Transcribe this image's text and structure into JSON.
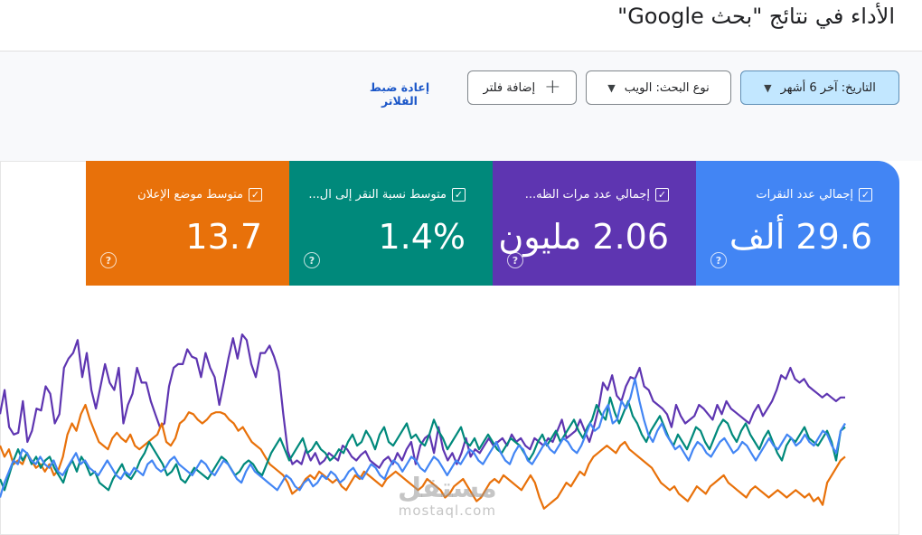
{
  "header": {
    "title": "الأداء في نتائج \"بحث Google\""
  },
  "filters": {
    "date_label": "التاريخ: آخر 6 أشهر",
    "search_type_label": "نوع البحث: الويب",
    "add_filter_label": "إضافة فلتر",
    "reset_label": "إعادة ضبط الفلاتر"
  },
  "metrics": [
    {
      "label": "إجمالي عدد النقرات",
      "value": "29.6 ألف",
      "color": "#4285f4",
      "checked": true
    },
    {
      "label": "إجمالي عدد مرات الظه...",
      "value": "2.06 مليون",
      "color": "#5e35b1",
      "checked": true
    },
    {
      "label": "متوسط نسبة النقر إلى ال...",
      "value": "1.4%",
      "color": "#00897b",
      "checked": true
    },
    {
      "label": "متوسط موضع الإعلان",
      "value": "13.7",
      "color": "#e8710a",
      "checked": true
    }
  ],
  "watermark": {
    "arabic": "مستقل",
    "latin": "mostaql.com"
  },
  "chart_data": {
    "type": "line",
    "series": [
      {
        "color": "#5e35b1",
        "values": [
          0.55,
          0.68,
          0.48,
          0.44,
          0.45,
          0.62,
          0.4,
          0.46,
          0.58,
          0.57,
          0.7,
          0.66,
          0.5,
          0.55,
          0.8,
          0.85,
          0.88,
          0.95,
          0.75,
          0.88,
          0.68,
          0.58,
          0.7,
          0.82,
          0.72,
          0.68,
          0.8,
          0.5,
          0.6,
          0.66,
          0.8,
          0.72,
          0.72,
          0.62,
          0.55,
          0.48,
          0.5,
          0.7,
          0.8,
          0.82,
          0.82,
          0.9,
          0.86,
          0.85,
          0.75,
          0.88,
          0.8,
          0.75,
          0.6,
          0.72,
          0.85,
          0.96,
          0.85,
          0.98,
          0.95,
          0.82,
          0.75,
          0.88,
          0.88,
          0.92,
          0.86,
          0.78,
          0.55,
          0.35,
          0.28,
          0.3,
          0.28,
          0.36,
          0.3,
          0.34,
          0.28,
          0.3,
          0.34,
          0.32,
          0.3,
          0.38,
          0.36,
          0.32,
          0.3,
          0.33,
          0.35,
          0.3,
          0.28,
          0.26,
          0.3,
          0.32,
          0.28,
          0.34,
          0.3,
          0.36,
          0.4,
          0.28,
          0.38,
          0.42,
          0.44,
          0.34,
          0.48,
          0.36,
          0.3,
          0.34,
          0.28,
          0.34,
          0.42,
          0.32,
          0.36,
          0.34,
          0.38,
          0.42,
          0.38,
          0.4,
          0.42,
          0.38,
          0.44,
          0.4,
          0.42,
          0.38,
          0.36,
          0.42,
          0.4,
          0.38,
          0.42,
          0.4,
          0.46,
          0.52,
          0.42,
          0.44,
          0.46,
          0.52,
          0.46,
          0.4,
          0.48,
          0.58,
          0.72,
          0.68,
          0.76,
          0.65,
          0.62,
          0.7,
          0.75,
          0.74,
          0.8,
          0.7,
          0.68,
          0.62,
          0.6,
          0.58,
          0.55,
          0.48,
          0.6,
          0.54,
          0.5,
          0.52,
          0.54,
          0.6,
          0.58,
          0.55,
          0.52,
          0.6,
          0.55,
          0.62,
          0.58,
          0.56,
          0.54,
          0.52,
          0.5,
          0.56,
          0.6,
          0.54,
          0.58,
          0.62,
          0.68,
          0.76,
          0.74,
          0.8,
          0.74,
          0.72,
          0.74,
          0.7,
          0.68,
          0.66,
          0.64,
          0.66,
          0.64,
          0.62,
          0.64,
          0.64
        ]
      },
      {
        "color": "#e8710a",
        "values": [
          0.38,
          0.32,
          0.36,
          0.28,
          0.3,
          0.28,
          0.34,
          0.3,
          0.26,
          0.28,
          0.24,
          0.28,
          0.22,
          0.25,
          0.32,
          0.44,
          0.5,
          0.46,
          0.55,
          0.6,
          0.52,
          0.46,
          0.4,
          0.38,
          0.36,
          0.42,
          0.45,
          0.42,
          0.4,
          0.44,
          0.38,
          0.36,
          0.38,
          0.4,
          0.42,
          0.44,
          0.5,
          0.4,
          0.38,
          0.42,
          0.5,
          0.52,
          0.56,
          0.55,
          0.52,
          0.5,
          0.52,
          0.55,
          0.56,
          0.56,
          0.55,
          0.52,
          0.5,
          0.46,
          0.48,
          0.44,
          0.4,
          0.38,
          0.36,
          0.32,
          0.28,
          0.26,
          0.24,
          0.22,
          0.18,
          0.12,
          0.14,
          0.16,
          0.2,
          0.22,
          0.2,
          0.24,
          0.22,
          0.2,
          0.18,
          0.2,
          0.16,
          0.14,
          0.18,
          0.22,
          0.2,
          0.24,
          0.22,
          0.2,
          0.18,
          0.16,
          0.2,
          0.22,
          0.24,
          0.22,
          0.2,
          0.18,
          0.16,
          0.14,
          0.16,
          0.2,
          0.18,
          0.16,
          0.14,
          0.1,
          0.12,
          0.16,
          0.18,
          0.2,
          0.16,
          0.12,
          0.08,
          0.1,
          0.14,
          0.18,
          0.2,
          0.18,
          0.22,
          0.2,
          0.18,
          0.16,
          0.14,
          0.18,
          0.22,
          0.18,
          0.1,
          0.04,
          0.06,
          0.08,
          0.1,
          0.14,
          0.18,
          0.16,
          0.2,
          0.24,
          0.22,
          0.28,
          0.32,
          0.34,
          0.36,
          0.38,
          0.36,
          0.34,
          0.38,
          0.4,
          0.36,
          0.34,
          0.32,
          0.3,
          0.28,
          0.26,
          0.22,
          0.18,
          0.16,
          0.14,
          0.16,
          0.12,
          0.1,
          0.08,
          0.12,
          0.16,
          0.14,
          0.12,
          0.16,
          0.18,
          0.2,
          0.22,
          0.18,
          0.16,
          0.14,
          0.12,
          0.1,
          0.14,
          0.16,
          0.14,
          0.12,
          0.1,
          0.12,
          0.14,
          0.12,
          0.1,
          0.12,
          0.14,
          0.12,
          0.1,
          0.12,
          0.08,
          0.1,
          0.06,
          0.18,
          0.22,
          0.26,
          0.3,
          0.32
        ]
      },
      {
        "color": "#00897b",
        "values": [
          0.2,
          0.14,
          0.22,
          0.3,
          0.36,
          0.3,
          0.34,
          0.28,
          0.32,
          0.26,
          0.3,
          0.32,
          0.26,
          0.22,
          0.18,
          0.26,
          0.3,
          0.24,
          0.32,
          0.28,
          0.22,
          0.24,
          0.18,
          0.16,
          0.14,
          0.2,
          0.24,
          0.28,
          0.22,
          0.2,
          0.24,
          0.3,
          0.34,
          0.4,
          0.36,
          0.32,
          0.28,
          0.22,
          0.24,
          0.28,
          0.2,
          0.18,
          0.22,
          0.26,
          0.24,
          0.22,
          0.2,
          0.24,
          0.28,
          0.32,
          0.3,
          0.26,
          0.22,
          0.24,
          0.28,
          0.3,
          0.28,
          0.24,
          0.22,
          0.28,
          0.34,
          0.38,
          0.42,
          0.36,
          0.3,
          0.34,
          0.38,
          0.42,
          0.34,
          0.36,
          0.4,
          0.36,
          0.34,
          0.3,
          0.32,
          0.36,
          0.34,
          0.4,
          0.44,
          0.38,
          0.4,
          0.46,
          0.42,
          0.36,
          0.44,
          0.48,
          0.4,
          0.38,
          0.42,
          0.46,
          0.5,
          0.42,
          0.44,
          0.4,
          0.38,
          0.44,
          0.52,
          0.46,
          0.42,
          0.36,
          0.4,
          0.44,
          0.48,
          0.4,
          0.38,
          0.42,
          0.36,
          0.4,
          0.44,
          0.4,
          0.36,
          0.34,
          0.38,
          0.42,
          0.4,
          0.38,
          0.34,
          0.3,
          0.34,
          0.4,
          0.44,
          0.38,
          0.42,
          0.46,
          0.4,
          0.44,
          0.48,
          0.52,
          0.46,
          0.42,
          0.48,
          0.52,
          0.6,
          0.55,
          0.52,
          0.64,
          0.56,
          0.5,
          0.56,
          0.62,
          0.54,
          0.5,
          0.44,
          0.4,
          0.46,
          0.5,
          0.54,
          0.48,
          0.42,
          0.38,
          0.44,
          0.4,
          0.36,
          0.42,
          0.48,
          0.46,
          0.4,
          0.36,
          0.42,
          0.48,
          0.52,
          0.5,
          0.44,
          0.4,
          0.46,
          0.5,
          0.44,
          0.4,
          0.36,
          0.42,
          0.46,
          0.4,
          0.34,
          0.3,
          0.38,
          0.42,
          0.4,
          0.44,
          0.48,
          0.42,
          0.4,
          0.38,
          0.42,
          0.46,
          0.4,
          0.3,
          0.46,
          0.48
        ]
      },
      {
        "color": "#4285f4",
        "values": [
          0.1,
          0.18,
          0.24,
          0.3,
          0.28,
          0.36,
          0.34,
          0.3,
          0.28,
          0.32,
          0.28,
          0.26,
          0.3,
          0.24,
          0.22,
          0.26,
          0.3,
          0.34,
          0.28,
          0.3,
          0.26,
          0.24,
          0.22,
          0.26,
          0.3,
          0.26,
          0.22,
          0.2,
          0.24,
          0.22,
          0.26,
          0.24,
          0.22,
          0.28,
          0.3,
          0.26,
          0.24,
          0.26,
          0.3,
          0.32,
          0.28,
          0.26,
          0.24,
          0.22,
          0.26,
          0.3,
          0.28,
          0.24,
          0.22,
          0.26,
          0.3,
          0.28,
          0.24,
          0.2,
          0.18,
          0.24,
          0.28,
          0.24,
          0.22,
          0.2,
          0.18,
          0.16,
          0.14,
          0.18,
          0.22,
          0.2,
          0.16,
          0.14,
          0.18,
          0.2,
          0.16,
          0.18,
          0.22,
          0.2,
          0.24,
          0.22,
          0.18,
          0.2,
          0.24,
          0.26,
          0.22,
          0.2,
          0.24,
          0.28,
          0.26,
          0.22,
          0.2,
          0.26,
          0.3,
          0.28,
          0.24,
          0.28,
          0.32,
          0.3,
          0.26,
          0.24,
          0.28,
          0.32,
          0.3,
          0.26,
          0.22,
          0.26,
          0.3,
          0.28,
          0.32,
          0.36,
          0.34,
          0.3,
          0.28,
          0.32,
          0.36,
          0.4,
          0.34,
          0.3,
          0.28,
          0.34,
          0.38,
          0.36,
          0.3,
          0.28,
          0.32,
          0.36,
          0.4,
          0.36,
          0.34,
          0.38,
          0.42,
          0.4,
          0.36,
          0.34,
          0.38,
          0.44,
          0.5,
          0.46,
          0.48,
          0.56,
          0.6,
          0.5,
          0.52,
          0.62,
          0.58,
          0.64,
          0.74,
          0.62,
          0.52,
          0.44,
          0.4,
          0.46,
          0.5,
          0.44,
          0.4,
          0.36,
          0.38,
          0.34,
          0.3,
          0.36,
          0.4,
          0.38,
          0.34,
          0.32,
          0.36,
          0.4,
          0.42,
          0.38,
          0.34,
          0.36,
          0.4,
          0.38,
          0.34,
          0.3,
          0.34,
          0.38,
          0.42,
          0.38,
          0.36,
          0.4,
          0.44,
          0.42,
          0.38,
          0.4,
          0.44,
          0.4,
          0.38,
          0.42,
          0.46,
          0.44,
          0.38,
          0.34,
          0.46,
          0.5
        ]
      }
    ]
  }
}
